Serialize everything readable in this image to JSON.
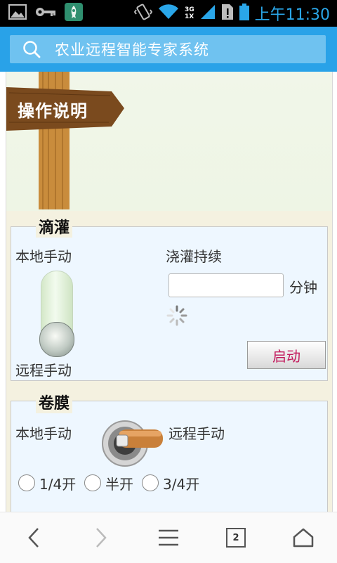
{
  "status_bar": {
    "network_label_top": "3G",
    "network_label_bottom": "1X",
    "time": "上午11:30"
  },
  "search": {
    "title": "农业远程智能专家系统"
  },
  "banner": {
    "sign_text": "操作说明"
  },
  "drip": {
    "legend": "滴灌",
    "local_label": "本地手动",
    "remote_label": "远程手动",
    "duration_label": "浇灌持续",
    "duration_value": "",
    "unit_label": "分钟",
    "start_button": "启动"
  },
  "film": {
    "legend": "卷膜",
    "local_label": "本地手动",
    "remote_label": "远程手动",
    "options": [
      "1/4开",
      "半开",
      "3/4开"
    ]
  },
  "nav": {
    "tab_count": "2"
  },
  "colors": {
    "accent": "#29a2e8",
    "status_text": "#2aa6e8",
    "button_text": "#c2185b"
  }
}
